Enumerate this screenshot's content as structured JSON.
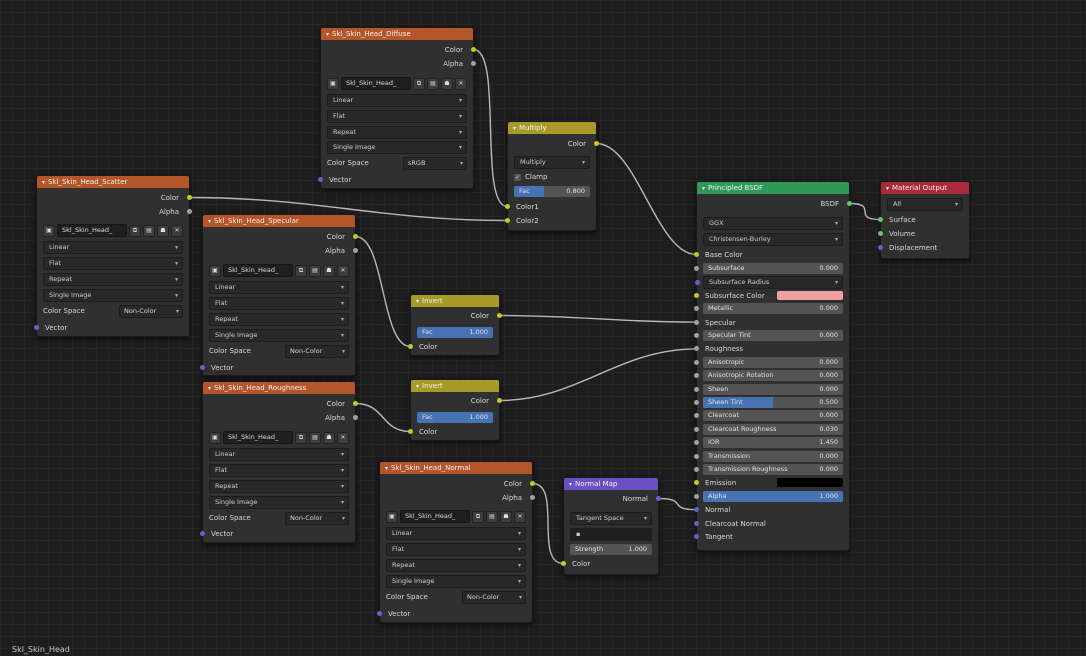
{
  "footer_label": "Skl_Skin_Head",
  "image_nodes": {
    "diffuse": {
      "title": "Skl_Skin_Head_Diffuse",
      "outputs": [
        "Color",
        "Alpha"
      ],
      "image_name": "Skl_Skin_Head_",
      "interpolation": "Linear",
      "projection": "Flat",
      "extension": "Repeat",
      "source": "Single Image",
      "color_space_label": "Color Space",
      "color_space": "sRGB",
      "input": "Vector"
    },
    "scatter": {
      "title": "Skl_Skin_Head_Scatter",
      "outputs": [
        "Color",
        "Alpha"
      ],
      "image_name": "Skl_Skin_Head_",
      "interpolation": "Linear",
      "projection": "Flat",
      "extension": "Repeat",
      "source": "Single Image",
      "color_space_label": "Color Space",
      "color_space": "Non-Color",
      "input": "Vector"
    },
    "specular": {
      "title": "Skl_Skin_Head_Specular",
      "outputs": [
        "Color",
        "Alpha"
      ],
      "image_name": "Skl_Skin_Head_",
      "interpolation": "Linear",
      "projection": "Flat",
      "extension": "Repeat",
      "source": "Single Image",
      "color_space_label": "Color Space",
      "color_space": "Non-Color",
      "input": "Vector"
    },
    "roughness": {
      "title": "Skl_Skin_Head_Roughness",
      "outputs": [
        "Color",
        "Alpha"
      ],
      "image_name": "Skl_Skin_Head_",
      "interpolation": "Linear",
      "projection": "Flat",
      "extension": "Repeat",
      "source": "Single Image",
      "color_space_label": "Color Space",
      "color_space": "Non-Color",
      "input": "Vector"
    },
    "normal": {
      "title": "Skl_Skin_Head_Normal",
      "outputs": [
        "Color",
        "Alpha"
      ],
      "image_name": "Skl_Skin_Head_",
      "interpolation": "Linear",
      "projection": "Flat",
      "extension": "Repeat",
      "source": "Single Image",
      "color_space_label": "Color Space",
      "color_space": "Non-Color",
      "input": "Vector"
    }
  },
  "multiply": {
    "title": "Multiply",
    "output": "Color",
    "blend_mode": "Multiply",
    "clamp": "Clamp",
    "fac_label": "Fac",
    "fac_value": "0.800",
    "fac_fill": 0.4,
    "input1": "Color1",
    "input2": "Color2"
  },
  "invert_spec": {
    "title": "Invert",
    "output": "Color",
    "fac_label": "Fac",
    "fac_value": "1.000",
    "input": "Color"
  },
  "invert_rough": {
    "title": "Invert",
    "output": "Color",
    "fac_label": "Fac",
    "fac_value": "1.000",
    "input": "Color"
  },
  "normal_map": {
    "title": "Normal Map",
    "output": "Normal",
    "space": "Tangent Space",
    "uv": "",
    "strength_label": "Strength",
    "strength_value": "1.000",
    "input": "Color"
  },
  "principled": {
    "title": "Principled BSDF",
    "output": "BSDF",
    "distribution": "GGX",
    "subsurface_method": "Christensen-Burley",
    "base_color": "Base Color",
    "rows": [
      {
        "label": "Subsurface",
        "value": "0.000"
      },
      {
        "label": "Subsurface Radius",
        "value": ""
      },
      {
        "label": "Subsurface Color",
        "value": ""
      },
      {
        "label": "Metallic",
        "value": "0.000"
      },
      {
        "label": "Specular",
        "value": ""
      },
      {
        "label": "Specular Tint",
        "value": "0.000"
      },
      {
        "label": "Roughness",
        "value": ""
      },
      {
        "label": "Anisotropic",
        "value": "0.000"
      },
      {
        "label": "Anisotropic Rotation",
        "value": "0.000"
      },
      {
        "label": "Sheen",
        "value": "0.000"
      },
      {
        "label": "Sheen Tint",
        "value": "0.500"
      },
      {
        "label": "Clearcoat",
        "value": "0.000"
      },
      {
        "label": "Clearcoat Roughness",
        "value": "0.030"
      },
      {
        "label": "IOR",
        "value": "1.450"
      },
      {
        "label": "Transmission",
        "value": "0.000"
      },
      {
        "label": "Transmission Roughness",
        "value": "0.000"
      },
      {
        "label": "Emission",
        "value": ""
      },
      {
        "label": "Alpha",
        "value": "1.000"
      },
      {
        "label": "Normal",
        "value": ""
      },
      {
        "label": "Clearcoat Normal",
        "value": ""
      },
      {
        "label": "Tangent",
        "value": ""
      }
    ],
    "subsurface_color": "#f0a0a0",
    "emission_color": "#000000",
    "sheen_tint_fill": 0.5,
    "alpha_fill": 1.0
  },
  "material_output": {
    "title": "Material Output",
    "target": "All",
    "inputs": [
      "Surface",
      "Volume",
      "Displacement"
    ]
  }
}
